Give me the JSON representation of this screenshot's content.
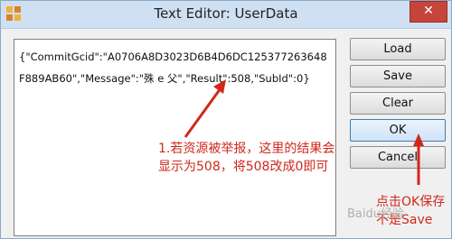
{
  "window": {
    "title": "Text Editor: UserData",
    "close_label": "✕"
  },
  "editor": {
    "content": "{\"CommitGcid\":\"A0706A8D3023D6B4D6DC125377263648F889AB60\",\"Message\":\"殊 e 父\",\"Result\":508,\"SubId\":0}"
  },
  "buttons": {
    "load": "Load",
    "save": "Save",
    "clear": "Clear",
    "ok": "OK",
    "cancel": "Cancel"
  },
  "annotations": {
    "note1_line1": "1.若资源被举报，这里的结果会",
    "note1_line2": "显示为508，将508改成0即可",
    "note2_line1": "点击OK保存",
    "note2_line2": "不是Save"
  },
  "watermark": "Baidu经验",
  "colors": {
    "annotation": "#d0281b",
    "title_bar": "#cfe0f3",
    "close": "#c6453b"
  }
}
